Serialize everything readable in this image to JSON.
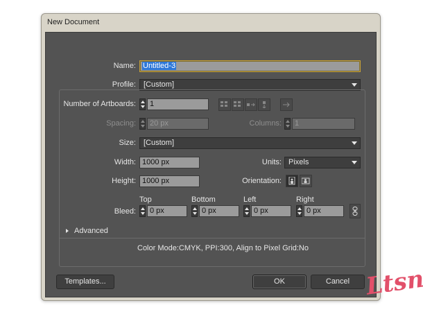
{
  "window": {
    "title": "New Document"
  },
  "form": {
    "name_label": "Name:",
    "name_value": "Untitled-3",
    "profile_label": "Profile:",
    "profile_value": "[Custom]",
    "artboards_label": "Number of Artboards:",
    "artboards_value": "1",
    "spacing_label": "Spacing:",
    "spacing_value": "20 px",
    "columns_label": "Columns:",
    "columns_value": "1",
    "size_label": "Size:",
    "size_value": "[Custom]",
    "width_label": "Width:",
    "width_value": "1000 px",
    "units_label": "Units:",
    "units_value": "Pixels",
    "height_label": "Height:",
    "height_value": "1000 px",
    "orientation_label": "Orientation:",
    "bleed_label": "Bleed:",
    "bleed": {
      "top_label": "Top",
      "top_value": "0 px",
      "bottom_label": "Bottom",
      "bottom_value": "0 px",
      "left_label": "Left",
      "left_value": "0 px",
      "right_label": "Right",
      "right_value": "0 px"
    },
    "advanced_label": "Advanced",
    "summary": "Color Mode:CMYK, PPI:300, Align to Pixel Grid:No"
  },
  "buttons": {
    "templates": "Templates...",
    "ok": "OK",
    "cancel": "Cancel"
  },
  "icons": {
    "arrange_options": [
      "grid-by-row-icon",
      "grid-by-column-icon",
      "arrange-by-row-icon",
      "arrange-by-column-icon",
      "layout-direction-icon"
    ],
    "orientation": [
      "portrait-icon",
      "landscape-icon"
    ],
    "bleed_link": "link-icon",
    "disclosure": "disclosure-triangle-icon"
  },
  "colors": {
    "dialog_bg": "#535353",
    "field_bg": "#9b9b9b",
    "selection": "#2e78d8",
    "window_chrome": "#d8d4c8",
    "watermark": "#e2506a"
  },
  "watermark": {
    "text": "Ltsn"
  }
}
